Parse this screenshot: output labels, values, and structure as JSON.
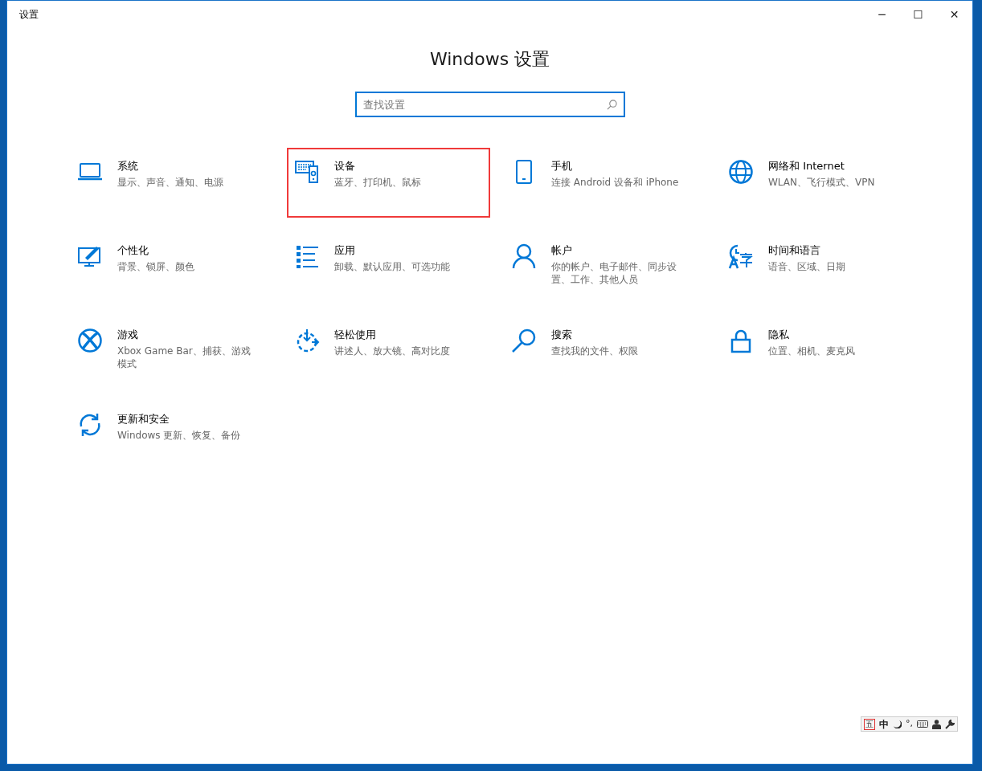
{
  "window": {
    "title": "设置",
    "controls": [
      "─",
      "☐",
      "✕"
    ]
  },
  "heading": "Windows 设置",
  "search": {
    "placeholder": "查找设置"
  },
  "categories": [
    {
      "title": "系统",
      "description": "显示、声音、通知、电源",
      "highlighted": false
    },
    {
      "title": "设备",
      "description": "蓝牙、打印机、鼠标",
      "highlighted": true
    },
    {
      "title": "手机",
      "description": "连接 Android 设备和 iPhone",
      "highlighted": false
    },
    {
      "title": "网络和 Internet",
      "description": "WLAN、飞行模式、VPN",
      "highlighted": false
    },
    {
      "title": "个性化",
      "description": "背景、锁屏、颜色",
      "highlighted": false
    },
    {
      "title": "应用",
      "description": "卸载、默认应用、可选功能",
      "highlighted": false
    },
    {
      "title": "帐户",
      "description": "你的帐户、电子邮件、同步设置、工作、其他人员",
      "highlighted": false
    },
    {
      "title": "时间和语言",
      "description": "语音、区域、日期",
      "highlighted": false
    },
    {
      "title": "游戏",
      "description": "Xbox Game Bar、捕获、游戏模式",
      "highlighted": false
    },
    {
      "title": "轻松使用",
      "description": "讲述人、放大镜、高对比度",
      "highlighted": false
    },
    {
      "title": "搜索",
      "description": "查找我的文件、权限",
      "highlighted": false
    },
    {
      "title": "隐私",
      "description": "位置、相机、麦克风",
      "highlighted": false
    },
    {
      "title": "更新和安全",
      "description": "Windows 更新、恢复、备份",
      "highlighted": false
    }
  ],
  "ime_bar": {
    "mode": "五",
    "language": "中",
    "punctuation": "°,"
  }
}
